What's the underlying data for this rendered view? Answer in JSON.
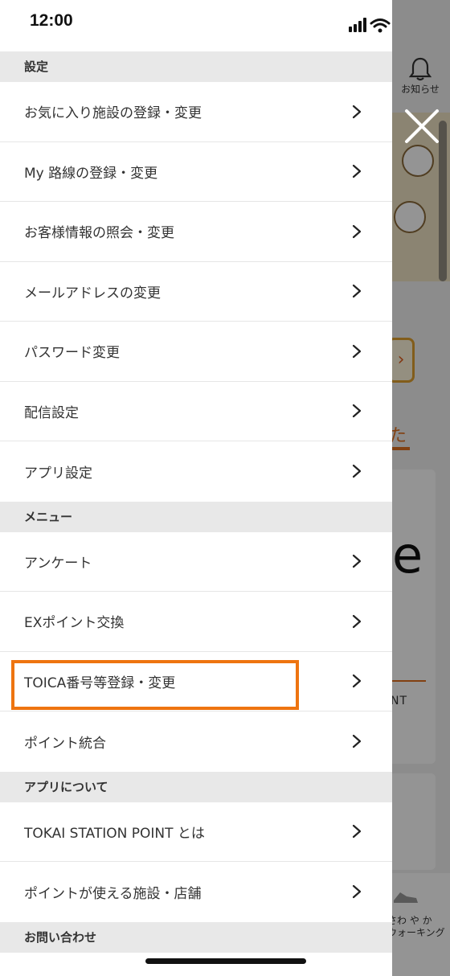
{
  "status_bar": {
    "time": "12:00"
  },
  "background": {
    "notification_label": "お知らせ",
    "tab_glyph": "た",
    "card_letter": "e",
    "card_text": "NT",
    "walking_label_line1": "さわ や か",
    "walking_label_line2": "ウォーキング",
    "accent_color": "#e07020"
  },
  "drawer": {
    "sections": [
      {
        "header": "設定",
        "items": [
          {
            "label": "お気に入り施設の登録・変更"
          },
          {
            "label": "My 路線の登録・変更"
          },
          {
            "label": "お客様情報の照会・変更"
          },
          {
            "label": "メールアドレスの変更"
          },
          {
            "label": "パスワード変更"
          },
          {
            "label": "配信設定"
          },
          {
            "label": "アプリ設定"
          }
        ]
      },
      {
        "header": "メニュー",
        "items": [
          {
            "label": "アンケート"
          },
          {
            "label": "EXポイント交換"
          },
          {
            "label": "TOICA番号等登録・変更"
          },
          {
            "label": "ポイント統合"
          }
        ]
      },
      {
        "header": "アプリについて",
        "items": [
          {
            "label": "TOKAI STATION POINT とは"
          },
          {
            "label": "ポイントが使える施設・店舗"
          }
        ]
      },
      {
        "header": "お問い合わせ",
        "items": []
      }
    ],
    "highlight_color": "#ee7410"
  }
}
